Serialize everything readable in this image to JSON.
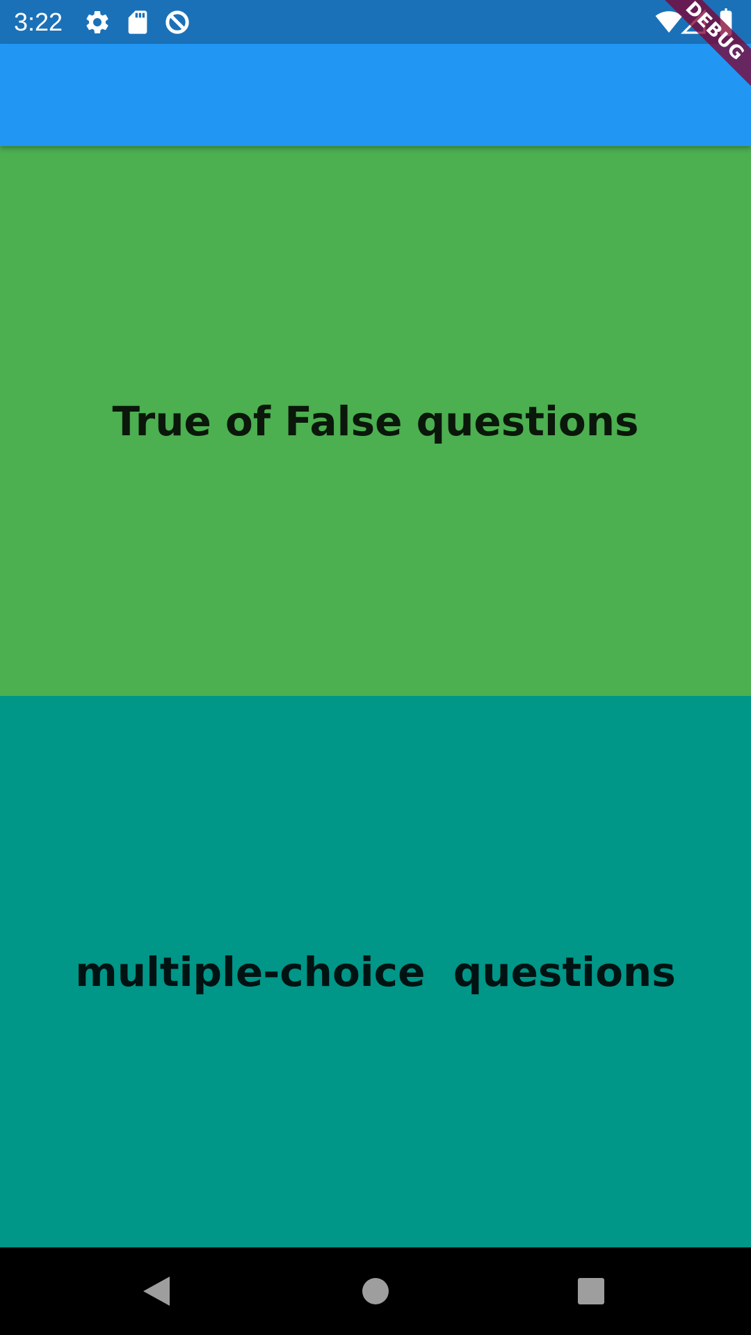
{
  "status_bar": {
    "time": "3:22",
    "icons_left": [
      "settings-icon",
      "sd-card-icon",
      "data-saver-icon"
    ],
    "icons_right": [
      "wifi-icon",
      "cell-signal-icon",
      "battery-icon"
    ],
    "background": "#1a71b8"
  },
  "app_bar": {
    "background": "#2196f3"
  },
  "debug_banner": {
    "label": "DEBUG"
  },
  "tiles": [
    {
      "label": "True of False questions",
      "color": "#4caf50"
    },
    {
      "label": "multiple-choice  questions",
      "color": "#009688"
    }
  ],
  "nav_bar": {
    "buttons": [
      "back-icon",
      "home-icon",
      "recents-icon"
    ]
  }
}
